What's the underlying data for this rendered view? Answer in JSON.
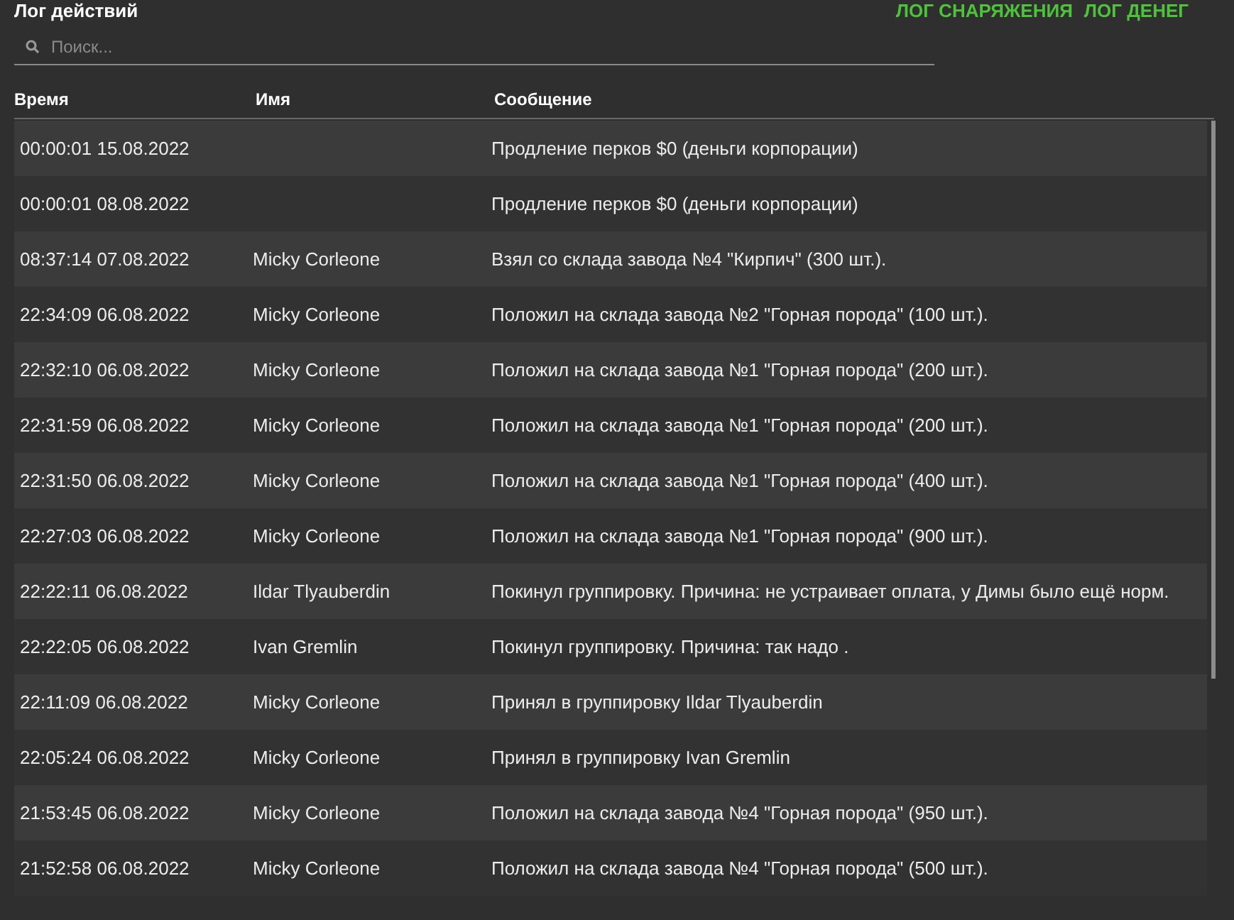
{
  "title": "Лог действий",
  "top_tabs": [
    {
      "label": "ЛОГ СНАРЯЖЕНИЯ"
    },
    {
      "label": "ЛОГ ДЕНЕГ"
    }
  ],
  "search": {
    "placeholder": "Поиск..."
  },
  "table": {
    "columns": [
      "Время",
      "Имя",
      "Сообщение"
    ],
    "rows": [
      {
        "time": "00:00:01 15.08.2022",
        "name": "",
        "message": "Продление перков $0 (деньги корпорации)"
      },
      {
        "time": "00:00:01 08.08.2022",
        "name": "",
        "message": "Продление перков $0 (деньги корпорации)"
      },
      {
        "time": "08:37:14 07.08.2022",
        "name": "Micky Corleone",
        "message": "Взял со склада завода №4 \"Кирпич\" (300 шт.)."
      },
      {
        "time": "22:34:09 06.08.2022",
        "name": "Micky Corleone",
        "message": "Положил на склада завода №2 \"Горная порода\" (100 шт.)."
      },
      {
        "time": "22:32:10 06.08.2022",
        "name": "Micky Corleone",
        "message": "Положил на склада завода №1 \"Горная порода\" (200 шт.)."
      },
      {
        "time": "22:31:59 06.08.2022",
        "name": "Micky Corleone",
        "message": "Положил на склада завода №1 \"Горная порода\" (200 шт.)."
      },
      {
        "time": "22:31:50 06.08.2022",
        "name": "Micky Corleone",
        "message": "Положил на склада завода №1 \"Горная порода\" (400 шт.)."
      },
      {
        "time": "22:27:03 06.08.2022",
        "name": "Micky Corleone",
        "message": "Положил на склада завода №1 \"Горная порода\" (900 шт.)."
      },
      {
        "time": "22:22:11 06.08.2022",
        "name": "Ildar Tlyauberdin",
        "message": "Покинул группировку. Причина: не устраивает оплата, у Димы было ещё норм."
      },
      {
        "time": "22:22:05 06.08.2022",
        "name": "Ivan Gremlin",
        "message": "Покинул группировку. Причина: так надо ."
      },
      {
        "time": "22:11:09 06.08.2022",
        "name": "Micky Corleone",
        "message": "Принял в группировку Ildar Tlyauberdin"
      },
      {
        "time": "22:05:24 06.08.2022",
        "name": "Micky Corleone",
        "message": "Принял в группировку Ivan Gremlin"
      },
      {
        "time": "21:53:45 06.08.2022",
        "name": "Micky Corleone",
        "message": "Положил на склада завода №4 \"Горная порода\" (950 шт.)."
      },
      {
        "time": "21:52:58 06.08.2022",
        "name": "Micky Corleone",
        "message": "Положил на склада завода №4 \"Горная порода\" (500 шт.)."
      }
    ]
  }
}
